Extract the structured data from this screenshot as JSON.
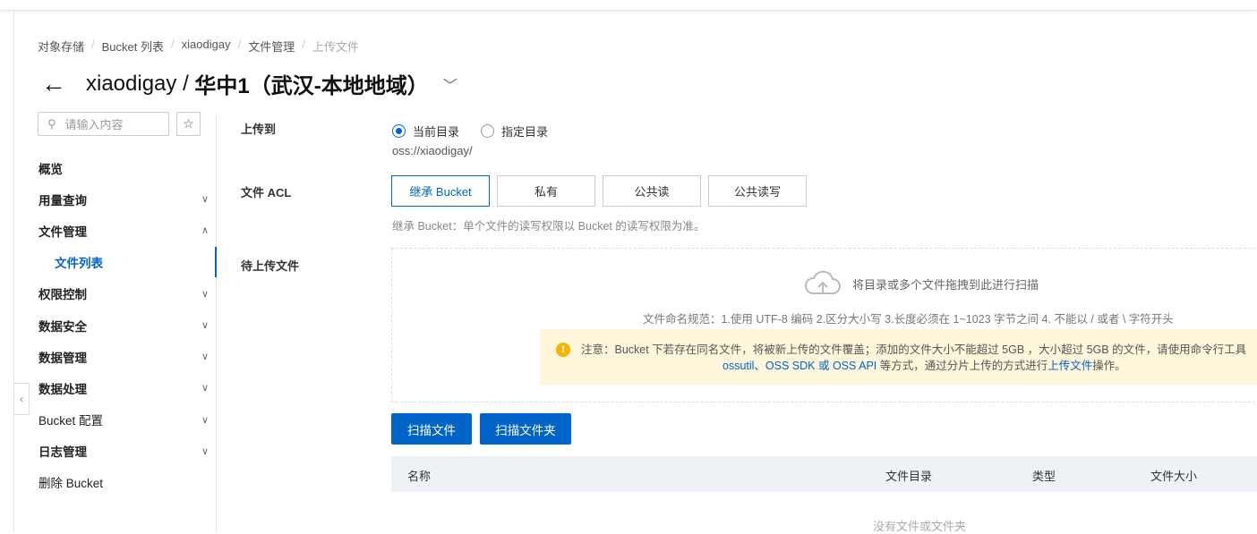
{
  "breadcrumb": [
    "对象存储",
    "Bucket 列表",
    "xiaodigay",
    "文件管理",
    "上传文件"
  ],
  "header": {
    "bucket": "xiaodigay /",
    "region": "华中1（武汉-本地地域）"
  },
  "search": {
    "placeholder": "请输入内容"
  },
  "sidebar": {
    "items": [
      {
        "label": "概览",
        "chevron": ""
      },
      {
        "label": "用量查询",
        "chevron": "down"
      },
      {
        "label": "文件管理",
        "chevron": "up"
      },
      {
        "label": "文件列表",
        "chevron": "",
        "active": true
      },
      {
        "label": "权限控制",
        "chevron": "down"
      },
      {
        "label": "数据安全",
        "chevron": "down"
      },
      {
        "label": "数据管理",
        "chevron": "down"
      },
      {
        "label": "数据处理",
        "chevron": "down"
      },
      {
        "label": "Bucket 配置",
        "chevron": "down"
      },
      {
        "label": "日志管理",
        "chevron": "down"
      },
      {
        "label": "删除 Bucket",
        "chevron": ""
      }
    ]
  },
  "form": {
    "upload_to_label": "上传到",
    "radio_current": "当前目录",
    "radio_specified": "指定目录",
    "path": "oss://xiaodigay/",
    "acl_label": "文件 ACL",
    "acl_options": [
      "继承 Bucket",
      "私有",
      "公共读",
      "公共读写"
    ],
    "acl_selected": "继承 Bucket",
    "acl_hint": "继承 Bucket：单个文件的读写权限以 Bucket 的读写权限为准。",
    "pending_label": "待上传文件",
    "drop_text": "将目录或多个文件拖拽到此进行扫描",
    "naming_rule": "文件命名规范：1.使用 UTF-8 编码 2.区分大小写 3.长度必须在 1~1023 字节之间 4. 不能以 / 或者 \\ 字符开头",
    "notice_line1": "注意：Bucket 下若存在同名文件，将被新上传的文件覆盖；添加的文件大小不能超过 5GB ，大小超过 5GB 的文件，请使用命令行工具",
    "notice_link1": "ossutil、OSS SDK 或 OSS API",
    "notice_mid": " 等方式，通过分片上传的方式进行",
    "notice_link2": "上传文件",
    "notice_end": "操作。",
    "scan_files": "扫描文件",
    "scan_folder": "扫描文件夹"
  },
  "table": {
    "columns": [
      "名称",
      "文件目录",
      "类型",
      "文件大小"
    ],
    "empty": "没有文件或文件夹"
  }
}
